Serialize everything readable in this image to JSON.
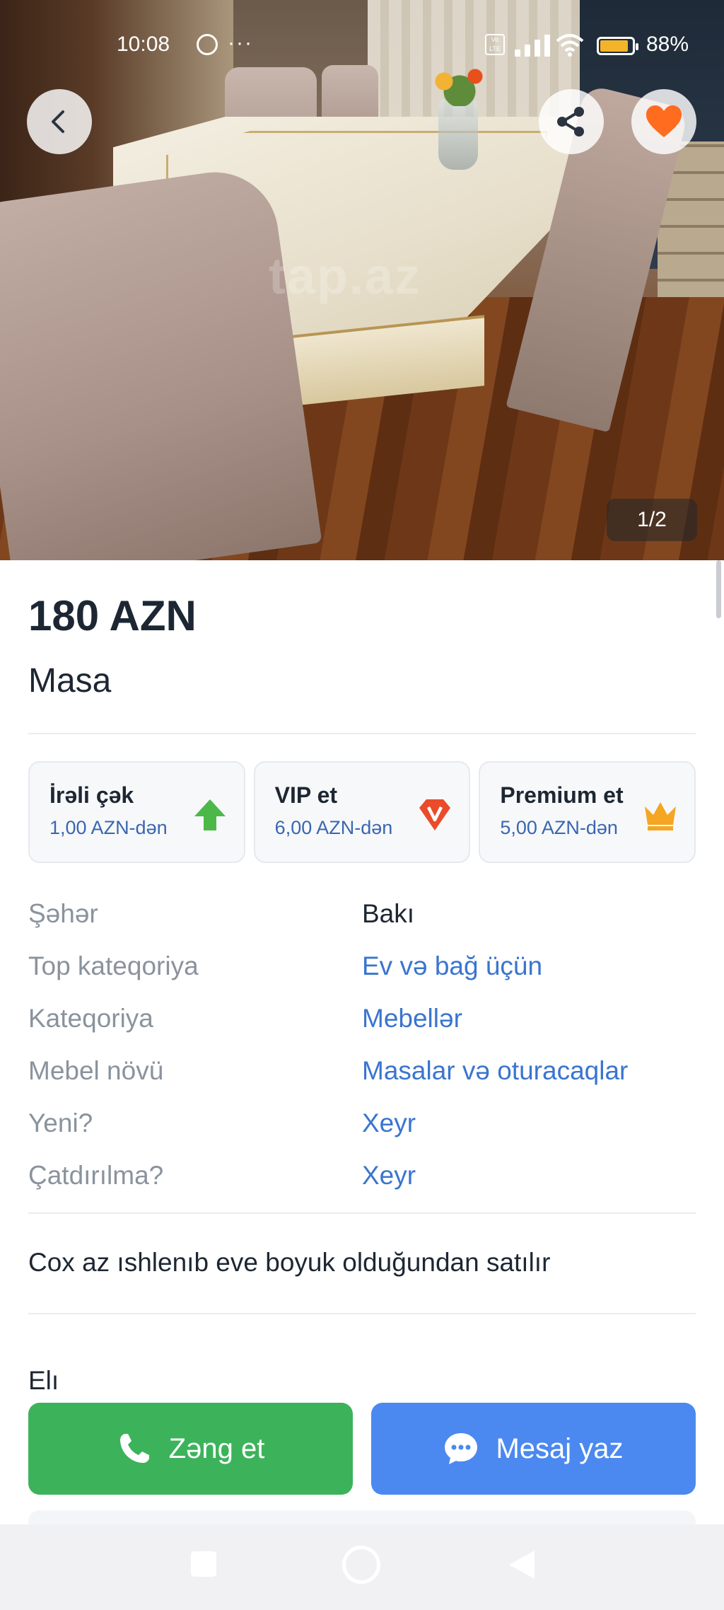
{
  "status_bar": {
    "time": "10:08",
    "volte": "Vo LTE",
    "battery_percent_text": "88%",
    "battery_level": 0.88
  },
  "gallery": {
    "counter": "1/2",
    "watermark": "tap.az"
  },
  "listing": {
    "price": "180 AZN",
    "title": "Masa"
  },
  "promotions": [
    {
      "title": "İrəli çək",
      "price": "1,00 AZN-dən",
      "icon": "arrow-up-icon",
      "color": "#4cb848"
    },
    {
      "title": "VIP et",
      "price": "6,00 AZN-dən",
      "icon": "vip-diamond-icon",
      "color": "#ea4b2a"
    },
    {
      "title": "Premium et",
      "price": "5,00 AZN-dən",
      "icon": "crown-icon",
      "color": "#f5a623"
    }
  ],
  "properties": [
    {
      "key": "Şəhər",
      "value": "Bakı"
    },
    {
      "key": "Top kateqoriya",
      "value": "Ev və bağ üçün"
    },
    {
      "key": "Kateqoriya",
      "value": "Mebellər"
    },
    {
      "key": "Mebel növü",
      "value": "Masalar və oturacaqlar"
    },
    {
      "key": "Yeni?",
      "value": "Xeyr"
    },
    {
      "key": "Çatdırılma?",
      "value": "Xeyr"
    }
  ],
  "description": "Cox az ıshlenıb eve boyuk olduğundan satılır",
  "section_label": "Elı",
  "actions": {
    "call_label": "Zəng et",
    "message_label": "Mesaj yaz"
  },
  "colors": {
    "accent_link": "#3a75cf",
    "call_green": "#3cb35b",
    "message_blue": "#4b89f0",
    "favorite": "#ff6b1f"
  }
}
